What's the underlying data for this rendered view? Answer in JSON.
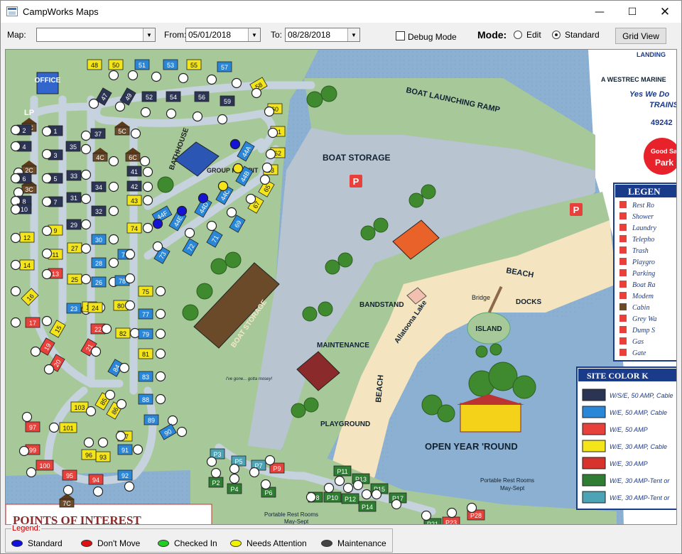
{
  "window": {
    "title": "CampWorks Maps"
  },
  "toolbar": {
    "map_label": "Map:",
    "map_value": "",
    "from_label": "From:",
    "from_value": "05/01/2018",
    "to_label": "To:",
    "to_value": "08/28/2018",
    "debug_label": "Debug Mode",
    "debug_checked": false,
    "mode_label": "Mode:",
    "mode_edit_label": "Edit",
    "mode_standard_label": "Standard",
    "mode_selected": "Standard",
    "grid_view_label": "Grid View"
  },
  "map": {
    "labels": {
      "office": "OFFICE",
      "lp": "LP",
      "bathhouse": "BATHHOUSE",
      "group_fire_pit": "GROUP FIRE PIT",
      "boat_launching_ramp": "BOAT LAUNCHING RAMP",
      "boat_storage_top": "BOAT STORAGE",
      "boat_storage_bldg": "BOAT STORAGE",
      "beach_top": "BEACH",
      "beach_side": "BEACH",
      "bandstand": "BANDSTAND",
      "docks": "DOCKS",
      "bridge": "Bridge",
      "island": "ISLAND",
      "lake": "Allatoona Lake",
      "maintenance": "MAINTENANCE",
      "playground": "PLAYGROUND",
      "open_year_round": "OPEN YEAR 'ROUND",
      "portable_rest_rooms_1": "Portable Rest Rooms",
      "portable_rest_rooms_1b": "May-Sept",
      "portable_rest_rooms_2": "Portable Rest Rooms",
      "portable_rest_rooms_2b": "May-Sept",
      "points_of_interest": "POINTS OF INTEREST",
      "westrec": "A WESTREC MARINE",
      "yes_we_do": "Yes We Do",
      "trains": "TRAINS",
      "phone_partial": "49242",
      "good_sam": "Good Sam",
      "park": "Park",
      "landing": "LANDING",
      "dog_sign": "I've gone... gotta mosey!"
    },
    "legend_panel": {
      "title": "LEGEN",
      "items": [
        "Rest Ro",
        "Shower",
        "Laundry",
        "Telepho",
        "Trash",
        "Playgro",
        "Parking",
        "Boat Ra",
        "Modem",
        "Cabin",
        "Grey Wa",
        "Dump S",
        "Gas",
        "Gate"
      ]
    },
    "site_color_panel": {
      "title": "SITE COLOR K",
      "items": [
        {
          "label": "W/S/E, 50 AMP, Cable",
          "color": "#2b3452"
        },
        {
          "label": "W/E, 50 AMP, Cable",
          "color": "#2a86d6"
        },
        {
          "label": "W/E, 50 AMP",
          "color": "#e8403a"
        },
        {
          "label": "W/E, 30 AMP, Cable",
          "color": "#f4e51a"
        },
        {
          "label": "W/E, 30 AMP",
          "color": "#d8322c"
        },
        {
          "label": "W/E, 30 AMP-Tent or",
          "color": "#2e7d32"
        },
        {
          "label": "W/E, 30 AMP-Tent or",
          "color": "#4ba3b5"
        }
      ]
    },
    "sites": [
      {
        "id": "48",
        "c": "#f4e51a"
      },
      {
        "id": "50",
        "c": "#f4e51a"
      },
      {
        "id": "51",
        "c": "#2a86d6"
      },
      {
        "id": "53",
        "c": "#2a86d6"
      },
      {
        "id": "55",
        "c": "#f4e51a"
      },
      {
        "id": "57",
        "c": "#2a86d6"
      },
      {
        "id": "47",
        "c": "#2b3452"
      },
      {
        "id": "49",
        "c": "#2b3452"
      },
      {
        "id": "52",
        "c": "#2b3452"
      },
      {
        "id": "54",
        "c": "#2b3452"
      },
      {
        "id": "56",
        "c": "#2b3452"
      },
      {
        "id": "59",
        "c": "#2b3452"
      },
      {
        "id": "58",
        "c": "#f4e51a"
      },
      {
        "id": "60",
        "c": "#f4e51a"
      },
      {
        "id": "61",
        "c": "#f4e51a"
      },
      {
        "id": "62",
        "c": "#f4e51a"
      },
      {
        "id": "63",
        "c": "#f4e51a"
      },
      {
        "id": "65",
        "c": "#f4e51a"
      },
      {
        "id": "67",
        "c": "#f4e51a"
      },
      {
        "id": "1C",
        "c": "#6b4a2a"
      },
      {
        "id": "2C",
        "c": "#6b4a2a"
      },
      {
        "id": "3C",
        "c": "#6b4a2a"
      },
      {
        "id": "4C",
        "c": "#6b4a2a"
      },
      {
        "id": "5C",
        "c": "#6b4a2a"
      },
      {
        "id": "6C",
        "c": "#6b4a2a"
      },
      {
        "id": "7C",
        "c": "#6b4a2a"
      },
      {
        "id": "1",
        "c": "#2b3452"
      },
      {
        "id": "2",
        "c": "#2b3452"
      },
      {
        "id": "3",
        "c": "#2b3452"
      },
      {
        "id": "4",
        "c": "#2b3452"
      },
      {
        "id": "5",
        "c": "#2b3452"
      },
      {
        "id": "6",
        "c": "#2b3452"
      },
      {
        "id": "7",
        "c": "#2b3452"
      },
      {
        "id": "8",
        "c": "#2b3452"
      },
      {
        "id": "10",
        "c": "#2b3452"
      },
      {
        "id": "35",
        "c": "#2b3452"
      },
      {
        "id": "37",
        "c": "#2b3452"
      },
      {
        "id": "33",
        "c": "#2b3452"
      },
      {
        "id": "34",
        "c": "#2b3452"
      },
      {
        "id": "31",
        "c": "#2b3452"
      },
      {
        "id": "32",
        "c": "#2b3452"
      },
      {
        "id": "29",
        "c": "#2b3452"
      },
      {
        "id": "41",
        "c": "#2b3452"
      },
      {
        "id": "42",
        "c": "#2b3452"
      },
      {
        "id": "43",
        "c": "#f4e51a"
      },
      {
        "id": "74",
        "c": "#f4e51a"
      },
      {
        "id": "9",
        "c": "#f4e51a"
      },
      {
        "id": "11",
        "c": "#f4e51a"
      },
      {
        "id": "12",
        "c": "#f4e51a"
      },
      {
        "id": "13",
        "c": "#e8403a"
      },
      {
        "id": "14",
        "c": "#f4e51a"
      },
      {
        "id": "16",
        "c": "#f4e51a"
      },
      {
        "id": "15",
        "c": "#f4e51a"
      },
      {
        "id": "17",
        "c": "#e8403a"
      },
      {
        "id": "19",
        "c": "#e8403a"
      },
      {
        "id": "20",
        "c": "#e8403a"
      },
      {
        "id": "21",
        "c": "#e8403a"
      },
      {
        "id": "22",
        "c": "#e8403a"
      },
      {
        "id": "23",
        "c": "#2a86d6"
      },
      {
        "id": "25",
        "c": "#f4e51a"
      },
      {
        "id": "26",
        "c": "#2a86d6"
      },
      {
        "id": "27",
        "c": "#f4e51a"
      },
      {
        "id": "28",
        "c": "#2a86d6"
      },
      {
        "id": "30",
        "c": "#2a86d6"
      },
      {
        "id": "76",
        "c": "#2a86d6"
      },
      {
        "id": "78",
        "c": "#2a86d6"
      },
      {
        "id": "80",
        "c": "#f4e51a"
      },
      {
        "id": "82",
        "c": "#f4e51a"
      },
      {
        "id": "84",
        "c": "#2a86d6"
      },
      {
        "id": "18",
        "c": "#f4e51a"
      },
      {
        "id": "24",
        "c": "#f4e51a"
      },
      {
        "id": "75",
        "c": "#f4e51a"
      },
      {
        "id": "77",
        "c": "#2a86d6"
      },
      {
        "id": "79",
        "c": "#2a86d6"
      },
      {
        "id": "81",
        "c": "#f4e51a"
      },
      {
        "id": "83",
        "c": "#2a86d6"
      },
      {
        "id": "85",
        "c": "#f4e51a"
      },
      {
        "id": "86",
        "c": "#f4e51a"
      },
      {
        "id": "88",
        "c": "#2a86d6"
      },
      {
        "id": "89",
        "c": "#2a86d6"
      },
      {
        "id": "90",
        "c": "#2a86d6"
      },
      {
        "id": "87",
        "c": "#f4e51a"
      },
      {
        "id": "91",
        "c": "#2a86d6"
      },
      {
        "id": "92",
        "c": "#2a86d6"
      },
      {
        "id": "93",
        "c": "#f4e51a"
      },
      {
        "id": "94",
        "c": "#e8403a"
      },
      {
        "id": "95",
        "c": "#e8403a"
      },
      {
        "id": "96",
        "c": "#f4e51a"
      },
      {
        "id": "97",
        "c": "#e8403a"
      },
      {
        "id": "99",
        "c": "#e8403a"
      },
      {
        "id": "100",
        "c": "#e8403a"
      },
      {
        "id": "101",
        "c": "#f4e51a"
      },
      {
        "id": "103",
        "c": "#f4e51a"
      },
      {
        "id": "44A",
        "c": "#2a86d6"
      },
      {
        "id": "44B",
        "c": "#2a86d6"
      },
      {
        "id": "44C",
        "c": "#2a86d6"
      },
      {
        "id": "44D",
        "c": "#2a86d6"
      },
      {
        "id": "44E",
        "c": "#2a86d6"
      },
      {
        "id": "44F",
        "c": "#2a86d6"
      },
      {
        "id": "69",
        "c": "#2a86d6"
      },
      {
        "id": "71",
        "c": "#2a86d6"
      },
      {
        "id": "72",
        "c": "#2a86d6"
      },
      {
        "id": "73",
        "c": "#2a86d6"
      },
      {
        "id": "P3",
        "c": "#4ba3b5"
      },
      {
        "id": "P5",
        "c": "#4ba3b5"
      },
      {
        "id": "P7",
        "c": "#4ba3b5"
      },
      {
        "id": "P9",
        "c": "#e8403a"
      },
      {
        "id": "P2",
        "c": "#2e7d32"
      },
      {
        "id": "P4",
        "c": "#2e7d32"
      },
      {
        "id": "P6",
        "c": "#2e7d32"
      },
      {
        "id": "P8",
        "c": "#2e7d32"
      },
      {
        "id": "P10",
        "c": "#2e7d32"
      },
      {
        "id": "P12",
        "c": "#2e7d32"
      },
      {
        "id": "P14",
        "c": "#2e7d32"
      },
      {
        "id": "P11",
        "c": "#2e7d32"
      },
      {
        "id": "P13",
        "c": "#2e7d32"
      },
      {
        "id": "P15",
        "c": "#2e7d32"
      },
      {
        "id": "P17",
        "c": "#2e7d32"
      },
      {
        "id": "P21",
        "c": "#2e7d32"
      },
      {
        "id": "P23",
        "c": "#e8403a"
      },
      {
        "id": "P28",
        "c": "#e8403a"
      }
    ],
    "status_markers": [
      {
        "site": "44A",
        "status": "Standard",
        "color": "#1414d6"
      },
      {
        "site": "44B",
        "status": "Needs Attention",
        "color": "#f4e51a"
      },
      {
        "site": "44C",
        "status": "Needs Attention",
        "color": "#f4e51a"
      },
      {
        "site": "44D",
        "status": "Standard",
        "color": "#1414d6"
      },
      {
        "site": "44E",
        "status": "Standard",
        "color": "#1414d6"
      },
      {
        "site": "44F",
        "status": "Standard",
        "color": "#1414d6"
      }
    ]
  },
  "legend": {
    "title": "Legend:",
    "items": [
      {
        "label": "Standard",
        "color": "#1010e0"
      },
      {
        "label": "Don't Move",
        "color": "#e01010"
      },
      {
        "label": "Checked In",
        "color": "#22cc22"
      },
      {
        "label": "Needs Attention",
        "color": "#f2f200"
      },
      {
        "label": "Maintenance",
        "color": "#444444"
      }
    ]
  }
}
